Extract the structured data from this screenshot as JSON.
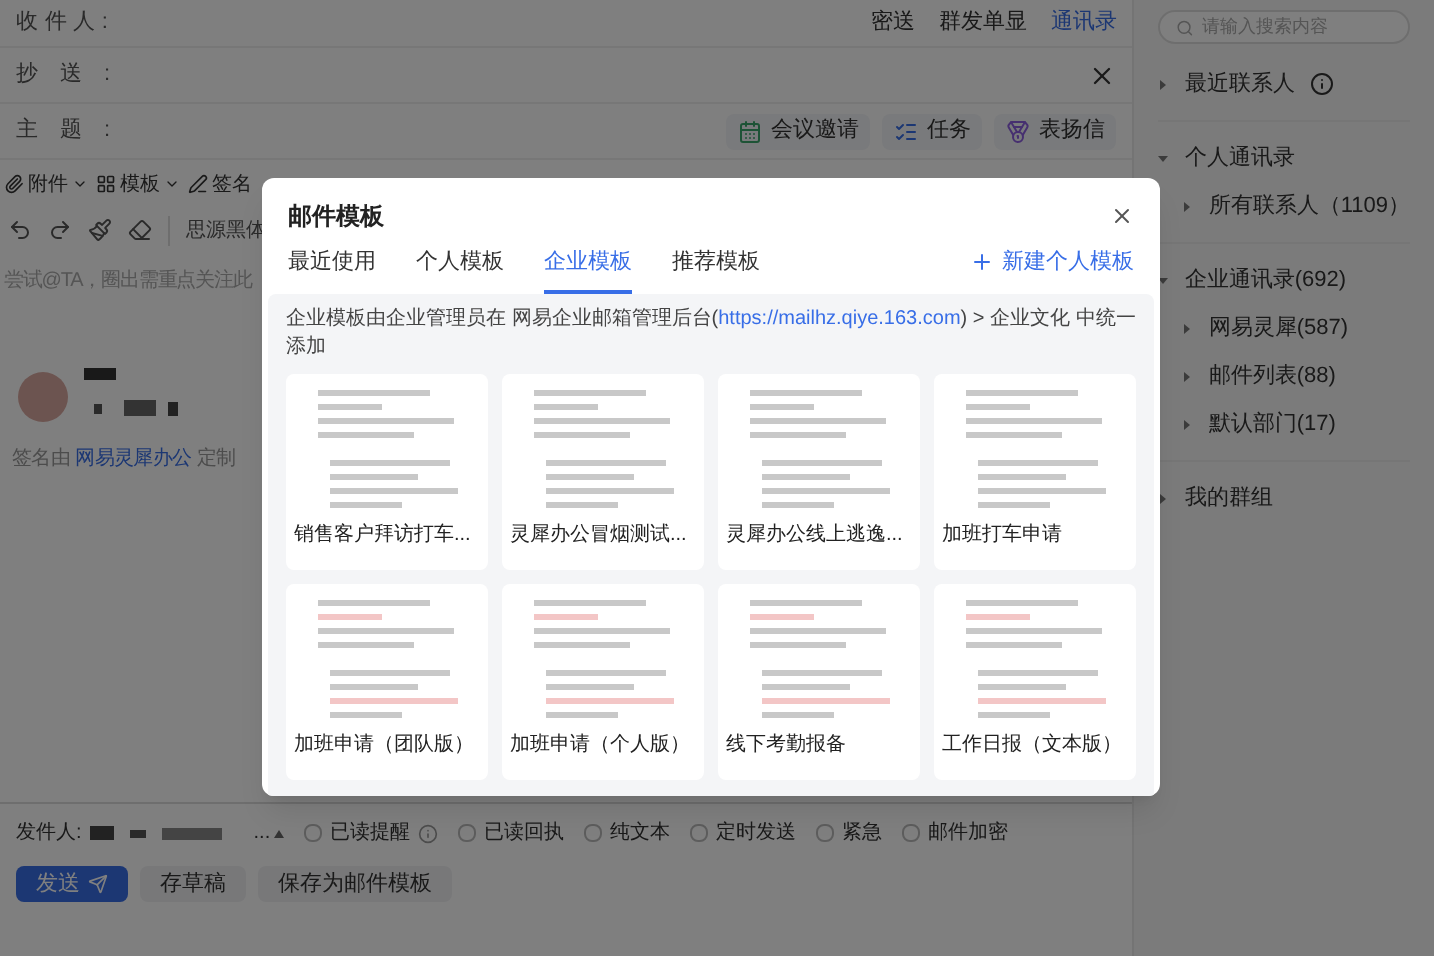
{
  "compose": {
    "to_label": "收件人:",
    "to_actions": [
      {
        "label": "密送",
        "selected": false
      },
      {
        "label": "群发单显",
        "selected": false
      },
      {
        "label": "通讯录",
        "selected": true
      }
    ],
    "cc_label": "抄送:",
    "subject_label": "主题:",
    "subject_actions": [
      {
        "label": "会议邀请",
        "kind": "meeting"
      },
      {
        "label": "任务",
        "kind": "task"
      },
      {
        "label": "表扬信",
        "kind": "praise"
      }
    ],
    "toolbar": [
      {
        "label": "附件",
        "kind": "attach"
      },
      {
        "label": "模板",
        "kind": "template"
      },
      {
        "label": "签名",
        "kind": "signature"
      }
    ],
    "font": "思源黑体",
    "placeholder": "尝试@TA，圈出需重点关注此",
    "signature_note": {
      "before": "签名由",
      "link": "网易灵犀办公",
      "after": "定制"
    }
  },
  "footer": {
    "sender_label": "发件人:",
    "sender_suffix": "...",
    "options": [
      {
        "label": "已读提醒",
        "checked": false,
        "info": true
      },
      {
        "label": "已读回执",
        "checked": false,
        "info": false
      },
      {
        "label": "纯文本",
        "checked": false,
        "info": false
      },
      {
        "label": "定时发送",
        "checked": false,
        "info": false
      },
      {
        "label": "紧急",
        "checked": false,
        "info": false
      },
      {
        "label": "邮件加密",
        "checked": false,
        "info": false
      }
    ],
    "buttons": [
      {
        "label": "发送",
        "kind": "primary"
      },
      {
        "label": "存草稿",
        "kind": "secondary"
      },
      {
        "label": "保存为邮件模板",
        "kind": "secondary"
      }
    ]
  },
  "sidebar": {
    "search": {
      "placeholder": "请输入搜索内容"
    },
    "tree": [
      {
        "label": "最近联系人",
        "expanded": false,
        "info": true
      },
      {
        "label": "个人通讯录",
        "expanded": true,
        "info": false,
        "children": [
          {
            "label": "所有联系人（1109）",
            "expanded": false
          }
        ]
      },
      {
        "label": "企业通讯录(692)",
        "expanded": true,
        "info": false,
        "children": [
          {
            "label": "网易灵犀(587)",
            "expanded": false
          },
          {
            "label": "邮件列表(88)",
            "expanded": false
          },
          {
            "label": "默认部门(17)",
            "expanded": false
          }
        ]
      },
      {
        "label": "我的群组",
        "expanded": false,
        "info": false
      }
    ]
  },
  "modal": {
    "title": "邮件模板",
    "tabs": [
      {
        "label": "最近使用",
        "selected": false
      },
      {
        "label": "个人模板",
        "selected": false
      },
      {
        "label": "企业模板",
        "selected": true
      },
      {
        "label": "推荐模板",
        "selected": false
      }
    ],
    "new_button": "新建个人模板",
    "notice": {
      "before": "企业模板由企业管理员在 网易企业邮箱管理后台(",
      "link": "https://mailhz.qiye.163.com",
      "after": ") > 企业文化 中统一添加"
    },
    "templates": [
      {
        "name": "销售客户拜访打车...",
        "highlighted": false
      },
      {
        "name": "灵犀办公冒烟测试...",
        "highlighted": false
      },
      {
        "name": "灵犀办公线上逃逸...",
        "highlighted": false
      },
      {
        "name": "加班打车申请",
        "highlighted": false
      },
      {
        "name": "加班申请（团队版）",
        "highlighted": true
      },
      {
        "name": "加班申请（个人版）",
        "highlighted": true
      },
      {
        "name": "线下考勤报备",
        "highlighted": true
      },
      {
        "name": "工作日报（文本版）",
        "highlighted": true
      }
    ]
  }
}
